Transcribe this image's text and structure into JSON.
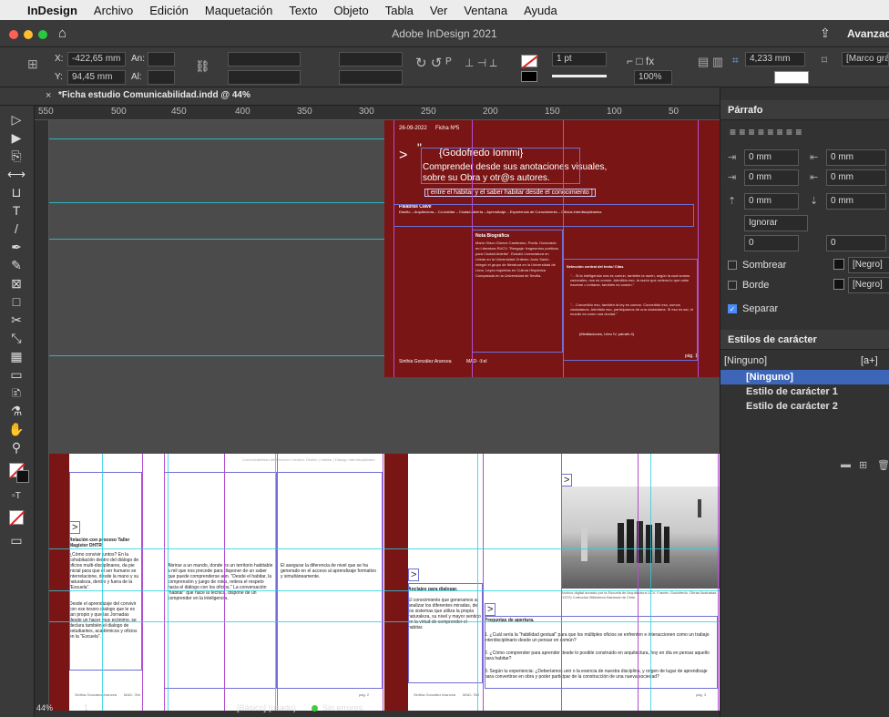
{
  "menubar": {
    "app": "InDesign",
    "items": [
      "Archivo",
      "Edición",
      "Maquetación",
      "Texto",
      "Objeto",
      "Tabla",
      "Ver",
      "Ventana",
      "Ayuda"
    ]
  },
  "titlebar": {
    "title": "Adobe InDesign 2021",
    "workspace": "Avanzado"
  },
  "control": {
    "x_label": "X:",
    "x_value": "-422,65 mm",
    "y_label": "Y:",
    "y_value": "94,45 mm",
    "w_label": "An:",
    "h_label": "Al:",
    "stroke": "1 pt",
    "zoom": "100%",
    "size": "4,233 mm",
    "frame_style": "[Marco gráfic"
  },
  "tab": {
    "title": "*Ficha estudio Comunicabilidad.indd @ 44%"
  },
  "ruler": {
    "ticks": [
      "550",
      "500",
      "450",
      "400",
      "350",
      "300",
      "250",
      "200",
      "150",
      "100",
      "50"
    ]
  },
  "top_spread": {
    "date": "26-09-2022",
    "tag": "Ficha Nº5",
    "name": "{Godofredo Iommi}",
    "line1": "Comprender desde sus anotaciones visuales,",
    "line2": "sobre su Obra y otr@s autores.",
    "subtitle": "[ entre el habitar y el saber habitar desde el conocimiento ]",
    "keywords_title": "Palabras Clave",
    "keywords": "Diseño – Arquitectura – Co-habitar – Ciudad Abierta – Aprendizaje – Experiencia de Conocimiento – Oficios interdisciplinarios",
    "bio_title": "Nota Biográfica",
    "bio": "Mario Olavo Gómez Cambrano, Poeta. Doctorado en Literatura RUCV. \"Bengaje: fragmentos poéticos para Ciudad Abierta\". Estudió Licenciatura en Letras en la Universidad Ordesto Jonio Sanin. Integró el grupo de literatura en la Universidad de Lima. Leyes inquietas en Cultura Hispánica Comparada en la Universidad de Sevilla.",
    "quote_title": "Selección central del texto/ Citas",
    "quote1": "\"... Si la inteligencia nos es común, también la razón, según la cual somos racionales, nos es común. Admitido eso, la razón que ordena lo que cabe hacerse o evitarse, también es común.\"",
    "quote2": "\"... Concedido eso, también la ley es común. Concedido eso, somos ciudadanos. Admitido eso, participamos de una ciudadanía. Si eso es así, el mundo es como una ciudad.\"",
    "quote_ref": "(Meditaciones, Libro IV, párrafo 4)",
    "author": "Sinthia González Arancea",
    "footer_code": "MAD- ①el",
    "page_no": "pág. 1"
  },
  "bottom_spread": {
    "p2_heading": "Relación con proceso Taller Magíster DHTR",
    "p2_intro": "¿Cómo convivir juntos? En la cohabitación dentro del diálogo de oficios multi-disciplinares, da pie inicial para que el ser humano se interrelacione, desde la mano y su naturaleza, dentro y fuera de la \"Escuela\".",
    "p2_body": "Desde el aprendizaje del convivir con ese tesoro dialogo que le es tan propio y que las Jornadas desde un hacer muy ecónimo, se declara también el dialogo de estudiantes, académicos y oficios en la \"Escuela\".",
    "col2_body": "Abrirse a un mundo, donde es un territorio habitable a mil que nos precede para disponer de un saber que puede comprenderse aún. \"Desde el habitar, la comprensión y juego de roles, reitera el respeto hacia el diálogo con los oficios.\" La conversación \"habitar\" que hace la técnica, dispone de un comprender en la inteligencia.",
    "col3_body": "El asegurar la diferencia de nivel que se ha generado en el acceso al aprendizaje formativo y simultáneamente.",
    "p3_heading": "Anclajes para dialogar.",
    "p3_body": "El conocimiento que generamos al analizar los diferentes miradas, de los sistemas que utiliza la propia naturaleza, su nivel y mayor sentido en la virtud de comprender el habitar.",
    "q_heading": "Preguntas de apertura.",
    "q1": "1. ¿Cuál sería la \"habilidad gestual\" para que los múltiples oficios se enfrenten e interaccionen como un trabajo interdisciplinario desde un pensar en común?",
    "q2": "2. ¿Cómo comprender para aprender desde lo posible construido en arquitectura, hoy en día en pensar aquello para habitar?",
    "q3": "3. Según tu experiencia: ¿Deberíamos unir o la esencia de nuestra disciplina, y origen de lugar de aprendizaje para convertirse en obra y poder participar de la construcción de una nueva sociedad?",
    "caption": "Archivo digital donado por la Escuela de Arquitectura UCV. Fuente: Godofredo. Obras Ilustradas (1972) Colección Biblioteca Nacional de Chile.",
    "page_no_a": "pág. 2",
    "page_no_b": "pág. 3",
    "running_head": "Comunicabilidad del Proceso Creativo: Diseño | Habitar | Diálogo Interdisciplinario"
  },
  "status": {
    "zoom": "44%",
    "page": "1",
    "style": "[Básico] (usado)",
    "errors": "Sin errores"
  },
  "paragraph_panel": {
    "title": "Párrafo",
    "fields": [
      "0 mm",
      "0 mm",
      "0 mm",
      "0 mm",
      "0 mm",
      "0 mm"
    ],
    "ignore": "Ignorar",
    "count_a": "0",
    "count_b": "0",
    "shade_label": "Sombrear",
    "shade_color": "[Negro]",
    "border_label": "Borde",
    "border_color": "[Negro]",
    "separate_label": "Separar"
  },
  "char_styles": {
    "title": "Estilos de carácter",
    "current": "[Ninguno]",
    "shortcut": "[a+]",
    "items": [
      "[Ninguno]",
      "Estilo de carácter 1",
      "Estilo de carácter 2"
    ]
  },
  "colors": {
    "accent": "#27d0e0",
    "maroon": "#7a1515",
    "margin": "#b44ecf"
  }
}
